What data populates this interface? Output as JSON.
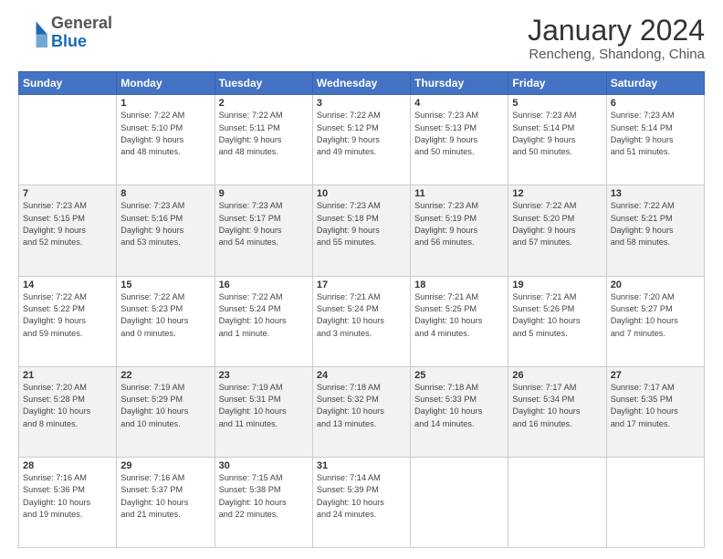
{
  "header": {
    "logo_general": "General",
    "logo_blue": "Blue",
    "month_year": "January 2024",
    "location": "Rencheng, Shandong, China"
  },
  "weekdays": [
    "Sunday",
    "Monday",
    "Tuesday",
    "Wednesday",
    "Thursday",
    "Friday",
    "Saturday"
  ],
  "weeks": [
    [
      {
        "day": "",
        "info": ""
      },
      {
        "day": "1",
        "info": "Sunrise: 7:22 AM\nSunset: 5:10 PM\nDaylight: 9 hours\nand 48 minutes."
      },
      {
        "day": "2",
        "info": "Sunrise: 7:22 AM\nSunset: 5:11 PM\nDaylight: 9 hours\nand 48 minutes."
      },
      {
        "day": "3",
        "info": "Sunrise: 7:22 AM\nSunset: 5:12 PM\nDaylight: 9 hours\nand 49 minutes."
      },
      {
        "day": "4",
        "info": "Sunrise: 7:23 AM\nSunset: 5:13 PM\nDaylight: 9 hours\nand 50 minutes."
      },
      {
        "day": "5",
        "info": "Sunrise: 7:23 AM\nSunset: 5:14 PM\nDaylight: 9 hours\nand 50 minutes."
      },
      {
        "day": "6",
        "info": "Sunrise: 7:23 AM\nSunset: 5:14 PM\nDaylight: 9 hours\nand 51 minutes."
      }
    ],
    [
      {
        "day": "7",
        "info": "Sunrise: 7:23 AM\nSunset: 5:15 PM\nDaylight: 9 hours\nand 52 minutes."
      },
      {
        "day": "8",
        "info": "Sunrise: 7:23 AM\nSunset: 5:16 PM\nDaylight: 9 hours\nand 53 minutes."
      },
      {
        "day": "9",
        "info": "Sunrise: 7:23 AM\nSunset: 5:17 PM\nDaylight: 9 hours\nand 54 minutes."
      },
      {
        "day": "10",
        "info": "Sunrise: 7:23 AM\nSunset: 5:18 PM\nDaylight: 9 hours\nand 55 minutes."
      },
      {
        "day": "11",
        "info": "Sunrise: 7:23 AM\nSunset: 5:19 PM\nDaylight: 9 hours\nand 56 minutes."
      },
      {
        "day": "12",
        "info": "Sunrise: 7:22 AM\nSunset: 5:20 PM\nDaylight: 9 hours\nand 57 minutes."
      },
      {
        "day": "13",
        "info": "Sunrise: 7:22 AM\nSunset: 5:21 PM\nDaylight: 9 hours\nand 58 minutes."
      }
    ],
    [
      {
        "day": "14",
        "info": "Sunrise: 7:22 AM\nSunset: 5:22 PM\nDaylight: 9 hours\nand 59 minutes."
      },
      {
        "day": "15",
        "info": "Sunrise: 7:22 AM\nSunset: 5:23 PM\nDaylight: 10 hours\nand 0 minutes."
      },
      {
        "day": "16",
        "info": "Sunrise: 7:22 AM\nSunset: 5:24 PM\nDaylight: 10 hours\nand 1 minute."
      },
      {
        "day": "17",
        "info": "Sunrise: 7:21 AM\nSunset: 5:24 PM\nDaylight: 10 hours\nand 3 minutes."
      },
      {
        "day": "18",
        "info": "Sunrise: 7:21 AM\nSunset: 5:25 PM\nDaylight: 10 hours\nand 4 minutes."
      },
      {
        "day": "19",
        "info": "Sunrise: 7:21 AM\nSunset: 5:26 PM\nDaylight: 10 hours\nand 5 minutes."
      },
      {
        "day": "20",
        "info": "Sunrise: 7:20 AM\nSunset: 5:27 PM\nDaylight: 10 hours\nand 7 minutes."
      }
    ],
    [
      {
        "day": "21",
        "info": "Sunrise: 7:20 AM\nSunset: 5:28 PM\nDaylight: 10 hours\nand 8 minutes."
      },
      {
        "day": "22",
        "info": "Sunrise: 7:19 AM\nSunset: 5:29 PM\nDaylight: 10 hours\nand 10 minutes."
      },
      {
        "day": "23",
        "info": "Sunrise: 7:19 AM\nSunset: 5:31 PM\nDaylight: 10 hours\nand 11 minutes."
      },
      {
        "day": "24",
        "info": "Sunrise: 7:18 AM\nSunset: 5:32 PM\nDaylight: 10 hours\nand 13 minutes."
      },
      {
        "day": "25",
        "info": "Sunrise: 7:18 AM\nSunset: 5:33 PM\nDaylight: 10 hours\nand 14 minutes."
      },
      {
        "day": "26",
        "info": "Sunrise: 7:17 AM\nSunset: 5:34 PM\nDaylight: 10 hours\nand 16 minutes."
      },
      {
        "day": "27",
        "info": "Sunrise: 7:17 AM\nSunset: 5:35 PM\nDaylight: 10 hours\nand 17 minutes."
      }
    ],
    [
      {
        "day": "28",
        "info": "Sunrise: 7:16 AM\nSunset: 5:36 PM\nDaylight: 10 hours\nand 19 minutes."
      },
      {
        "day": "29",
        "info": "Sunrise: 7:16 AM\nSunset: 5:37 PM\nDaylight: 10 hours\nand 21 minutes."
      },
      {
        "day": "30",
        "info": "Sunrise: 7:15 AM\nSunset: 5:38 PM\nDaylight: 10 hours\nand 22 minutes."
      },
      {
        "day": "31",
        "info": "Sunrise: 7:14 AM\nSunset: 5:39 PM\nDaylight: 10 hours\nand 24 minutes."
      },
      {
        "day": "",
        "info": ""
      },
      {
        "day": "",
        "info": ""
      },
      {
        "day": "",
        "info": ""
      }
    ]
  ]
}
